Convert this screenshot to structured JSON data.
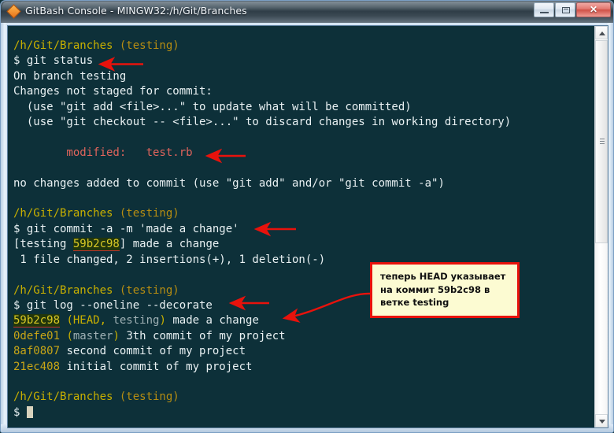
{
  "window": {
    "title": "GitBash Console - MINGW32:/h/Git/Branches",
    "icon": "git-diamond-icon",
    "minimize_label": "–",
    "maximize_label": "",
    "close_label": "✕"
  },
  "terminal": {
    "lines": [
      {
        "id": "l1",
        "segments": [
          {
            "text": "/h/Git/Branches ",
            "cls": "c-path"
          },
          {
            "text": "(testing)",
            "cls": "c-branch"
          }
        ]
      },
      {
        "id": "l2",
        "segments": [
          {
            "text": "$ git status",
            "cls": "c-white"
          }
        ]
      },
      {
        "id": "l3",
        "segments": [
          {
            "text": "On branch testing",
            "cls": "c-white"
          }
        ]
      },
      {
        "id": "l4",
        "segments": [
          {
            "text": "Changes not staged for commit:",
            "cls": "c-white"
          }
        ]
      },
      {
        "id": "l5",
        "segments": [
          {
            "text": "  (use \"git add <file>...\" to update what will be committed)",
            "cls": "c-white"
          }
        ]
      },
      {
        "id": "l6",
        "segments": [
          {
            "text": "  (use \"git checkout -- <file>...\" to discard changes in working directory)",
            "cls": "c-white"
          }
        ]
      },
      {
        "id": "l7",
        "segments": [
          {
            "text": "",
            "cls": "c-white"
          }
        ]
      },
      {
        "id": "l8",
        "segments": [
          {
            "text": "        modified:   test.rb",
            "cls": "c-red"
          }
        ]
      },
      {
        "id": "l9",
        "segments": [
          {
            "text": "",
            "cls": "c-white"
          }
        ]
      },
      {
        "id": "l10",
        "segments": [
          {
            "text": "no changes added to commit (use \"git add\" and/or \"git commit -a\")",
            "cls": "c-white"
          }
        ]
      },
      {
        "id": "l11",
        "segments": [
          {
            "text": "",
            "cls": "c-white"
          }
        ]
      },
      {
        "id": "l12",
        "segments": [
          {
            "text": "/h/Git/Branches ",
            "cls": "c-path"
          },
          {
            "text": "(testing)",
            "cls": "c-branch"
          }
        ]
      },
      {
        "id": "l13",
        "segments": [
          {
            "text": "$ git commit -a -m 'made a change'",
            "cls": "c-white"
          }
        ]
      },
      {
        "id": "l14",
        "segments": [
          {
            "text": "[testing ",
            "cls": "c-white"
          },
          {
            "text": "59b2c98",
            "cls": "c-hl"
          },
          {
            "text": "] made a change",
            "cls": "c-white"
          }
        ]
      },
      {
        "id": "l15",
        "segments": [
          {
            "text": " 1 file changed, 2 insertions(+), 1 deletion(-)",
            "cls": "c-white"
          }
        ]
      },
      {
        "id": "l16",
        "segments": [
          {
            "text": "",
            "cls": "c-white"
          }
        ]
      },
      {
        "id": "l17",
        "segments": [
          {
            "text": "/h/Git/Branches ",
            "cls": "c-path"
          },
          {
            "text": "(testing)",
            "cls": "c-branch"
          }
        ]
      },
      {
        "id": "l18",
        "segments": [
          {
            "text": "$ git log --oneline --decorate",
            "cls": "c-white"
          }
        ]
      },
      {
        "id": "l19",
        "segments": [
          {
            "text": "59b2c98",
            "cls": "c-hl"
          },
          {
            "text": " (HEAD, ",
            "cls": "c-yellow"
          },
          {
            "text": "testing",
            "cls": "c-gray"
          },
          {
            "text": ")",
            "cls": "c-yellow"
          },
          {
            "text": " made a change",
            "cls": "c-white"
          }
        ]
      },
      {
        "id": "l20",
        "segments": [
          {
            "text": "0defe01",
            "cls": "c-hash"
          },
          {
            "text": " (",
            "cls": "c-yellow"
          },
          {
            "text": "master",
            "cls": "c-gray"
          },
          {
            "text": ")",
            "cls": "c-yellow"
          },
          {
            "text": " 3th commit of my project",
            "cls": "c-white"
          }
        ]
      },
      {
        "id": "l21",
        "segments": [
          {
            "text": "8af0807",
            "cls": "c-hash"
          },
          {
            "text": " second commit of my project",
            "cls": "c-white"
          }
        ]
      },
      {
        "id": "l22",
        "segments": [
          {
            "text": "21ec408",
            "cls": "c-hash"
          },
          {
            "text": " initial commit of my project",
            "cls": "c-white"
          }
        ]
      },
      {
        "id": "l23",
        "segments": [
          {
            "text": "",
            "cls": "c-white"
          }
        ]
      },
      {
        "id": "l24",
        "segments": [
          {
            "text": "/h/Git/Branches ",
            "cls": "c-path"
          },
          {
            "text": "(testing)",
            "cls": "c-branch"
          }
        ]
      },
      {
        "id": "l25",
        "segments": [
          {
            "text": "$ ",
            "cls": "c-white"
          },
          {
            "text": "",
            "cls": "cursor-slot"
          }
        ]
      }
    ],
    "colors": {
      "background": "#0d3039",
      "foreground": "#e8f0f2",
      "path": "#c9b000",
      "branch": "#b68d12",
      "modified": "#e0645c",
      "hash": "#c9a616",
      "ref_gray": "#9fb0b4",
      "highlight_bg": "#22360c",
      "highlight_fg": "#d8c825"
    }
  },
  "annotations": {
    "callout": {
      "text_lines": [
        "теперь HEAD указывает",
        "на коммит 59b2c98 в",
        "ветке testing"
      ],
      "background": "#fcfbd2",
      "border_color": "#e8120c"
    },
    "arrows": [
      {
        "id": "arrow-git-status",
        "target": "git status"
      },
      {
        "id": "arrow-test-rb",
        "target": "test.rb"
      },
      {
        "id": "arrow-git-commit",
        "target": "git commit -a -m 'made a change'"
      },
      {
        "id": "arrow-git-log",
        "target": "git log --oneline --decorate"
      },
      {
        "id": "arrow-callout-curve",
        "target": "59b2c98 made a change"
      }
    ],
    "arrow_color": "#e8120c"
  },
  "scrollbar": {
    "up_label": "▲",
    "down_label": "▼"
  }
}
